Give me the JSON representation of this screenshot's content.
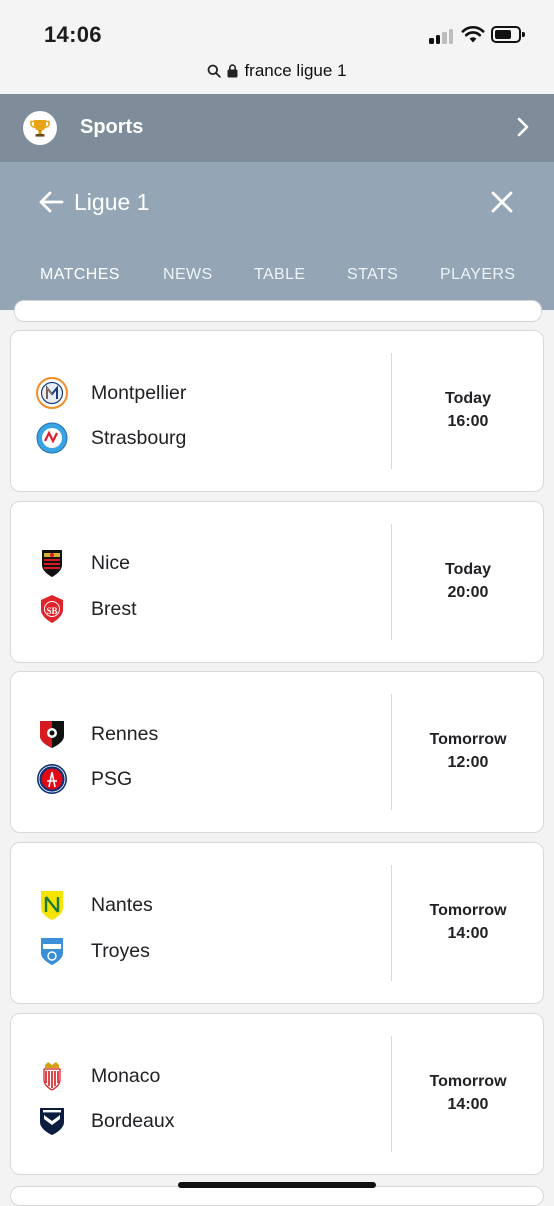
{
  "status": {
    "time": "14:06"
  },
  "url": {
    "text": "france ligue 1"
  },
  "sports_bar": {
    "title": "Sports"
  },
  "league": {
    "title": "Ligue 1"
  },
  "tabs": [
    {
      "label": "MATCHES",
      "active": true
    },
    {
      "label": "NEWS"
    },
    {
      "label": "TABLE"
    },
    {
      "label": "STATS"
    },
    {
      "label": "PLAYERS"
    }
  ],
  "matches": [
    {
      "home": "Montpellier",
      "away": "Strasbourg",
      "day": "Today",
      "time": "16:00"
    },
    {
      "home": "Nice",
      "away": "Brest",
      "day": "Today",
      "time": "20:00"
    },
    {
      "home": "Rennes",
      "away": "PSG",
      "day": "Tomorrow",
      "time": "12:00"
    },
    {
      "home": "Nantes",
      "away": "Troyes",
      "day": "Tomorrow",
      "time": "14:00"
    },
    {
      "home": "Monaco",
      "away": "Bordeaux",
      "day": "Tomorrow",
      "time": "14:00"
    }
  ],
  "colors": {
    "sports_bar": "#7f8c99",
    "league_bar": "#94a6b6"
  }
}
